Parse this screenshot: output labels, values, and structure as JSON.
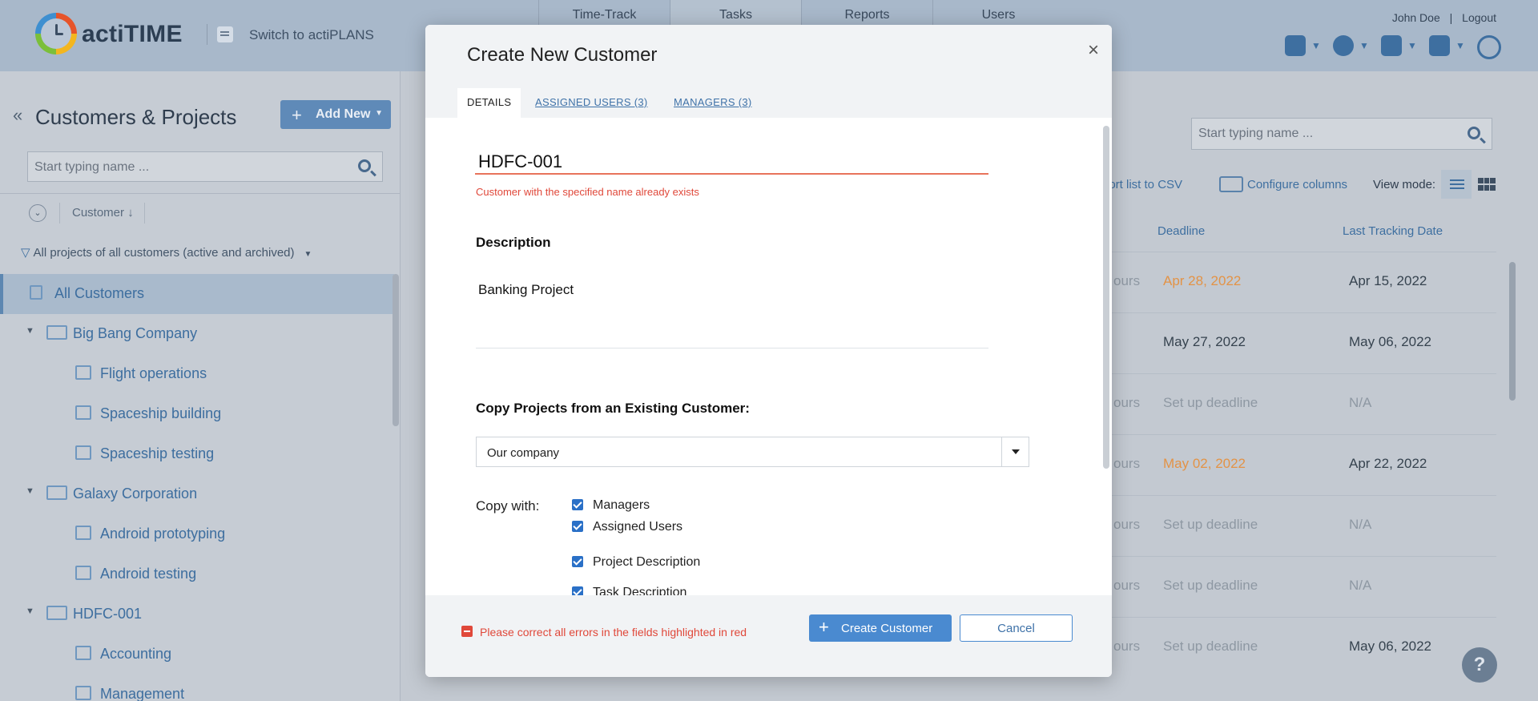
{
  "header": {
    "brand": "actiTIME",
    "switch_label": "Switch to actiPLANS",
    "nav": [
      "Time-Track",
      "Tasks",
      "Reports",
      "Users"
    ],
    "active_nav": "Tasks",
    "user_name": "John Doe",
    "separator": "|",
    "logout": "Logout",
    "icons": [
      "calendar-icon",
      "gear-icon",
      "puzzle-icon",
      "help-icon",
      "lightbulb-icon"
    ]
  },
  "left": {
    "title": "Customers & Projects",
    "add_new": "Add New",
    "search_placeholder": "Start typing name ...",
    "sort_label": "Customer",
    "filter_label": "All projects of all customers (active and archived)",
    "all_customers": "All Customers",
    "tree": [
      {
        "name": "Big Bang Company",
        "projects": [
          "Flight operations",
          "Spaceship building",
          "Spaceship testing"
        ]
      },
      {
        "name": "Galaxy Corporation",
        "projects": [
          "Android prototyping",
          "Android testing"
        ]
      },
      {
        "name": "HDFC-001",
        "projects": [
          "Accounting",
          "Management"
        ]
      }
    ]
  },
  "right": {
    "search_placeholder": "Start typing name ...",
    "export_label": "port list to CSV",
    "configure_columns": "Configure columns",
    "view_mode": "View mode:",
    "columns": {
      "deadline": "Deadline",
      "last_tracking": "Last Tracking Date"
    },
    "rows": [
      {
        "hours": "ours",
        "deadline": "Apr 28, 2022",
        "deadline_style": "orange",
        "last": "Apr 15, 2022"
      },
      {
        "hours": "",
        "deadline": "May 27, 2022",
        "deadline_style": "normal",
        "last": "May 06, 2022"
      },
      {
        "hours": "ours",
        "deadline": "Set up deadline",
        "deadline_style": "muted",
        "last": "N/A"
      },
      {
        "hours": "ours",
        "deadline": "May 02, 2022",
        "deadline_style": "orange",
        "last": "Apr 22, 2022"
      },
      {
        "hours": "ours",
        "deadline": "Set up deadline",
        "deadline_style": "muted",
        "last": "N/A"
      },
      {
        "hours": "ours",
        "deadline": "Set up deadline",
        "deadline_style": "muted",
        "last": "N/A"
      },
      {
        "hours": "ours",
        "deadline": "Set up deadline",
        "deadline_style": "muted",
        "last": "May 06, 2022"
      }
    ],
    "help": "?"
  },
  "modal": {
    "title": "Create New Customer",
    "close": "×",
    "tabs": {
      "details": "DETAILS",
      "assigned": "ASSIGNED USERS (3)",
      "managers": "MANAGERS (3)"
    },
    "name_value": "HDFC-001",
    "name_error": "Customer with the specified name already exists",
    "description_label": "Description",
    "description_value": "Banking Project",
    "copy_label": "Copy Projects from an Existing Customer:",
    "copy_select": "Our company",
    "copy_with_label": "Copy with:",
    "copy_options": [
      "Managers",
      "Assigned Users",
      "Project Description",
      "Task Description"
    ],
    "footer_error": "Please correct all errors in the fields highlighted in red",
    "create_button": "Create Customer",
    "cancel_button": "Cancel"
  },
  "colors": {
    "accent": "#4a8ad0",
    "error": "#e0483a",
    "deadline_orange": "#e39346"
  }
}
